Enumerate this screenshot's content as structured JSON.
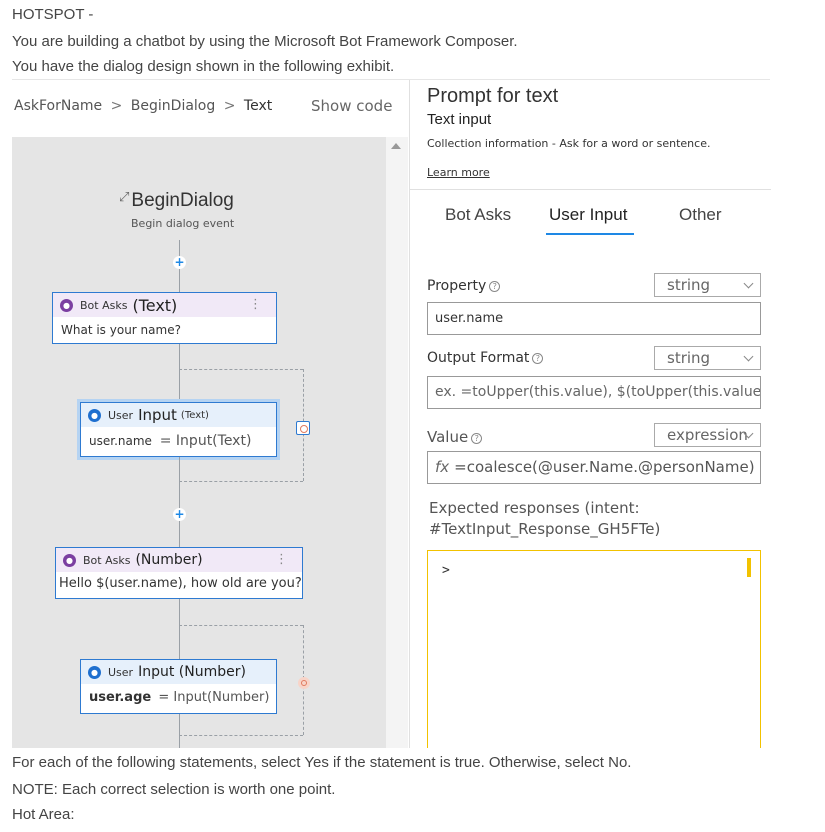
{
  "question": {
    "header": "HOTSPOT -",
    "intro": "You are building a chatbot by using the Microsoft Bot Framework Composer.",
    "exhibit": "You have the dialog design shown in the following exhibit.",
    "instruction": "For each of the following statements, select Yes if the statement is true. Otherwise, select No.",
    "note": "NOTE: Each correct selection is worth one point.",
    "hot_area": "Hot Area:"
  },
  "designer": {
    "breadcrumb": [
      "AskForName",
      "BeginDialog",
      "Text"
    ],
    "breadcrumb_separator": ">",
    "show_code": "Show code",
    "trigger": {
      "title": "BeginDialog",
      "subtitle": "Begin dialog event",
      "icon": "begin-dialog-icon"
    },
    "nodes": [
      {
        "kind": "Bot Asks",
        "type": "(Text)",
        "body_left": "What is your name?",
        "body_right": "",
        "icon": "bot-asks-icon"
      },
      {
        "kind": "User",
        "type": "Input",
        "type_suffix": "(Text)",
        "body_left": "user.name",
        "body_right": "= Input(Text)",
        "icon": "user-input-icon"
      },
      {
        "kind": "Bot Asks",
        "type": "(Number)",
        "body_left": "Hello $(user.name), how old are you?",
        "body_right": "",
        "icon": "bot-asks-icon"
      },
      {
        "kind": "User",
        "type": "Input (Number)",
        "type_suffix": "",
        "body_left": "user.age",
        "body_right": "= Input(Number)",
        "icon": "user-input-icon"
      }
    ],
    "menu_glyph": "⋮",
    "add_glyph": "+"
  },
  "properties": {
    "title": "Prompt for text",
    "subtitle": "Text input",
    "description": "Collection information - Ask for a word or sentence.",
    "learn_more": "Learn more",
    "tabs": [
      "Bot Asks",
      "User Input",
      "Other"
    ],
    "active_tab": "User Input",
    "property": {
      "label": "Property",
      "type": "string",
      "value": "user.name"
    },
    "output_format": {
      "label": "Output Format",
      "type": "string",
      "placeholder": "ex. =toUpper(this.value), $(toUpper(this.value))"
    },
    "value": {
      "label": "Value",
      "type": "expression",
      "fx": "fx",
      "value": "=coalesce(@user.Name.@personName)"
    },
    "expected_responses": "Expected responses (intent: #TextInput_Response_GH5FTe)",
    "editor_prompt": ">"
  },
  "colors": {
    "accent": "#1e88e5",
    "node_border": "#2e7ad1",
    "bot_asks": "#7b3fa1",
    "user_input": "#1e6fcf",
    "editor_focus": "#f2c200",
    "canvas": "#e5e5e5"
  }
}
